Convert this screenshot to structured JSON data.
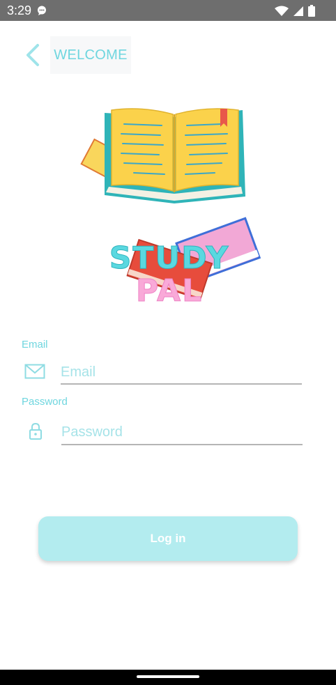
{
  "status_bar": {
    "time": "3:29",
    "icons": [
      "chat-notification-icon",
      "wifi-icon",
      "signal-icon",
      "battery-icon"
    ]
  },
  "header": {
    "back_icon": "chevron-left-icon",
    "title": "WELCOME"
  },
  "logo": {
    "line1": "STUDY",
    "line2": "PAL"
  },
  "form": {
    "email_label": "Email",
    "email_placeholder": "Email",
    "email_value": "",
    "email_icon": "envelope-icon",
    "password_label": "Password",
    "password_placeholder": "Password",
    "password_value": "",
    "password_icon": "lock-icon"
  },
  "login_button": {
    "label": "Log in"
  },
  "colors": {
    "accent": "#6fd6df",
    "button_bg": "#b3ecef",
    "pink": "#f9a9d8",
    "status_bar": "#6e6e6e"
  }
}
